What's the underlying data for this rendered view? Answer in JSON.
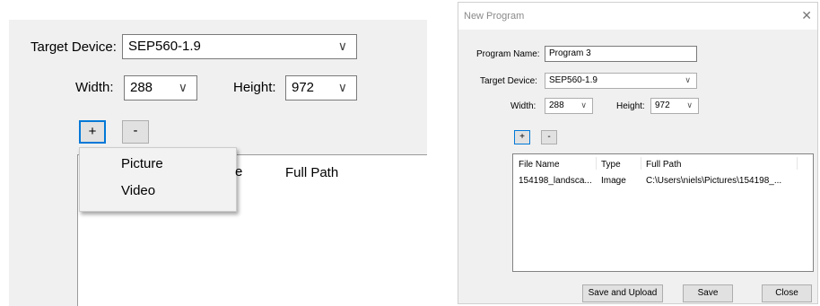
{
  "zoom": {
    "target_device_label": "Target Device:",
    "target_device_value": "SEP560-1.9",
    "width_label": "Width:",
    "width_value": "288",
    "height_label": "Height:",
    "height_value": "972",
    "add_label": "+",
    "remove_label": "-",
    "menu_items": [
      "Picture",
      "Video"
    ],
    "partial_header": "e",
    "full_path_header": "Full Path"
  },
  "dialog": {
    "title": "New Program",
    "close_glyph": "✕",
    "program_name_label": "Program Name:",
    "program_name_value": "Program 3",
    "target_device_label": "Target Device:",
    "target_device_value": "SEP560-1.9",
    "width_label": "Width:",
    "width_value": "288",
    "height_label": "Height:",
    "height_value": "972",
    "add_label": "+",
    "remove_label": "-",
    "columns": [
      "File Name",
      "Type",
      "Full Path"
    ],
    "rows": [
      {
        "file_name": "154198_landsca...",
        "type": "Image",
        "full_path": "C:\\Users\\niels\\Pictures\\154198_..."
      }
    ],
    "save_upload_label": "Save and Upload",
    "save_label": "Save",
    "close_label": "Close"
  }
}
